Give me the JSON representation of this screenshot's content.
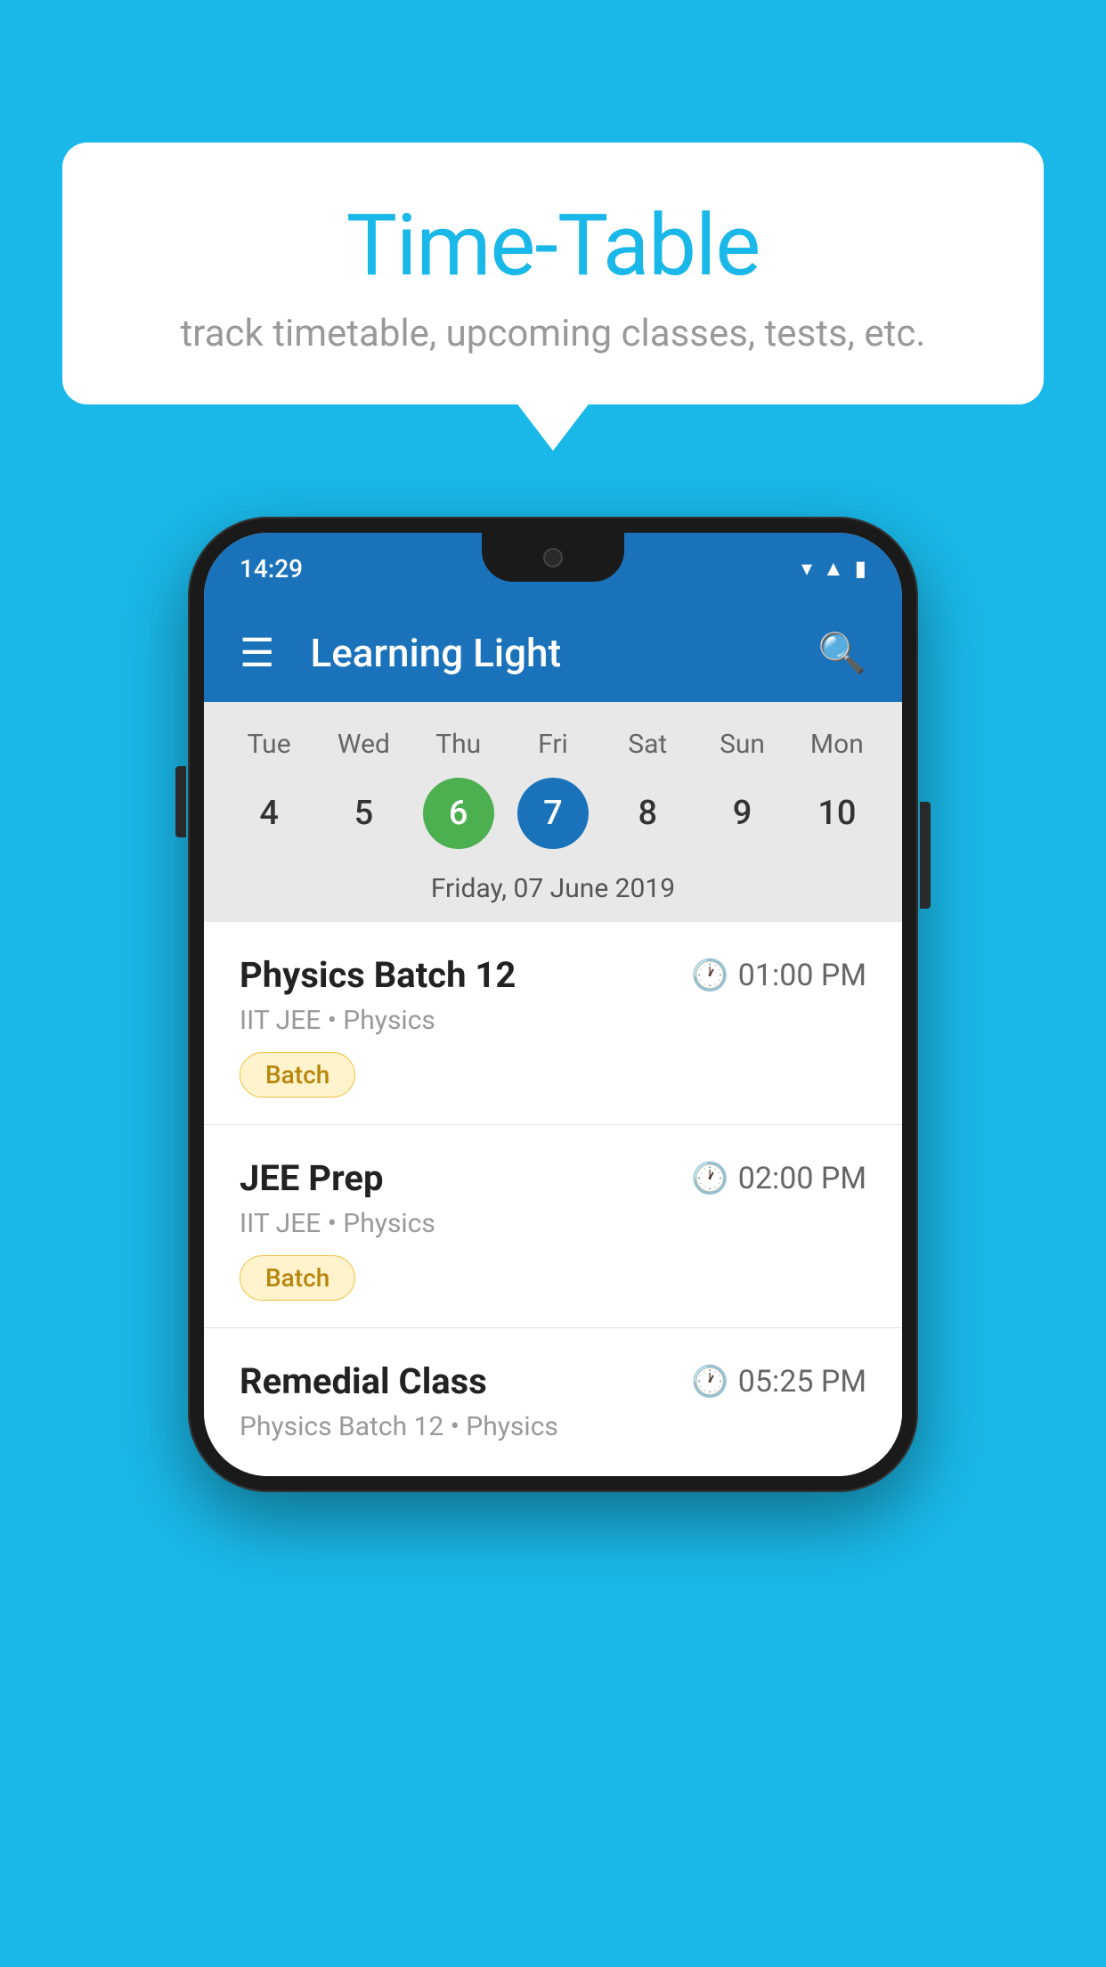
{
  "background_color": "#1ab8e8",
  "bubble": {
    "title": "Time-Table",
    "subtitle": "track timetable, upcoming classes, tests, etc."
  },
  "phone": {
    "status_bar": {
      "time": "14:29"
    },
    "app_bar": {
      "title": "Learning Light"
    },
    "calendar": {
      "days": [
        "Tue",
        "Wed",
        "Thu",
        "Fri",
        "Sat",
        "Sun",
        "Mon"
      ],
      "dates": [
        4,
        5,
        6,
        7,
        8,
        9,
        10
      ],
      "today_index": 2,
      "selected_index": 3,
      "selected_date_label": "Friday, 07 June 2019"
    },
    "classes": [
      {
        "name": "Physics Batch 12",
        "time": "01:00 PM",
        "subtitle": "IIT JEE • Physics",
        "badge": "Batch"
      },
      {
        "name": "JEE Prep",
        "time": "02:00 PM",
        "subtitle": "IIT JEE • Physics",
        "badge": "Batch"
      },
      {
        "name": "Remedial Class",
        "time": "05:25 PM",
        "subtitle": "Physics Batch 12 • Physics",
        "badge": null
      }
    ]
  },
  "icons": {
    "menu": "≡",
    "search": "🔍",
    "clock": "⏱"
  }
}
